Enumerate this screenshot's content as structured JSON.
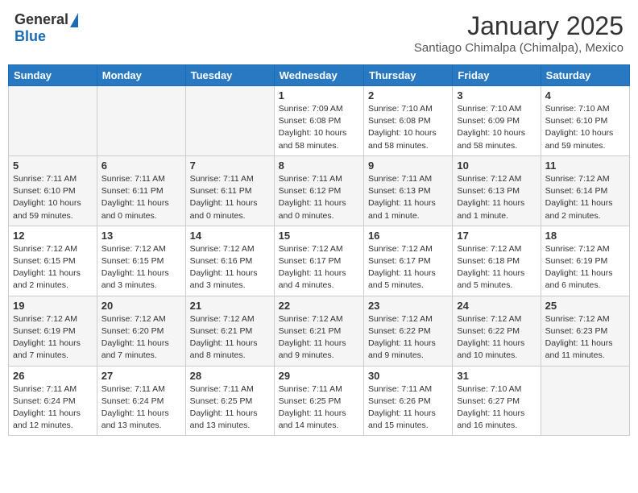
{
  "header": {
    "logo_general": "General",
    "logo_blue": "Blue",
    "title": "January 2025",
    "subtitle": "Santiago Chimalpa (Chimalpa), Mexico"
  },
  "days_of_week": [
    "Sunday",
    "Monday",
    "Tuesday",
    "Wednesday",
    "Thursday",
    "Friday",
    "Saturday"
  ],
  "weeks": [
    [
      {
        "day": "",
        "info": ""
      },
      {
        "day": "",
        "info": ""
      },
      {
        "day": "",
        "info": ""
      },
      {
        "day": "1",
        "info": "Sunrise: 7:09 AM\nSunset: 6:08 PM\nDaylight: 10 hours and 58 minutes."
      },
      {
        "day": "2",
        "info": "Sunrise: 7:10 AM\nSunset: 6:08 PM\nDaylight: 10 hours and 58 minutes."
      },
      {
        "day": "3",
        "info": "Sunrise: 7:10 AM\nSunset: 6:09 PM\nDaylight: 10 hours and 58 minutes."
      },
      {
        "day": "4",
        "info": "Sunrise: 7:10 AM\nSunset: 6:10 PM\nDaylight: 10 hours and 59 minutes."
      }
    ],
    [
      {
        "day": "5",
        "info": "Sunrise: 7:11 AM\nSunset: 6:10 PM\nDaylight: 10 hours and 59 minutes."
      },
      {
        "day": "6",
        "info": "Sunrise: 7:11 AM\nSunset: 6:11 PM\nDaylight: 11 hours and 0 minutes."
      },
      {
        "day": "7",
        "info": "Sunrise: 7:11 AM\nSunset: 6:11 PM\nDaylight: 11 hours and 0 minutes."
      },
      {
        "day": "8",
        "info": "Sunrise: 7:11 AM\nSunset: 6:12 PM\nDaylight: 11 hours and 0 minutes."
      },
      {
        "day": "9",
        "info": "Sunrise: 7:11 AM\nSunset: 6:13 PM\nDaylight: 11 hours and 1 minute."
      },
      {
        "day": "10",
        "info": "Sunrise: 7:12 AM\nSunset: 6:13 PM\nDaylight: 11 hours and 1 minute."
      },
      {
        "day": "11",
        "info": "Sunrise: 7:12 AM\nSunset: 6:14 PM\nDaylight: 11 hours and 2 minutes."
      }
    ],
    [
      {
        "day": "12",
        "info": "Sunrise: 7:12 AM\nSunset: 6:15 PM\nDaylight: 11 hours and 2 minutes."
      },
      {
        "day": "13",
        "info": "Sunrise: 7:12 AM\nSunset: 6:15 PM\nDaylight: 11 hours and 3 minutes."
      },
      {
        "day": "14",
        "info": "Sunrise: 7:12 AM\nSunset: 6:16 PM\nDaylight: 11 hours and 3 minutes."
      },
      {
        "day": "15",
        "info": "Sunrise: 7:12 AM\nSunset: 6:17 PM\nDaylight: 11 hours and 4 minutes."
      },
      {
        "day": "16",
        "info": "Sunrise: 7:12 AM\nSunset: 6:17 PM\nDaylight: 11 hours and 5 minutes."
      },
      {
        "day": "17",
        "info": "Sunrise: 7:12 AM\nSunset: 6:18 PM\nDaylight: 11 hours and 5 minutes."
      },
      {
        "day": "18",
        "info": "Sunrise: 7:12 AM\nSunset: 6:19 PM\nDaylight: 11 hours and 6 minutes."
      }
    ],
    [
      {
        "day": "19",
        "info": "Sunrise: 7:12 AM\nSunset: 6:19 PM\nDaylight: 11 hours and 7 minutes."
      },
      {
        "day": "20",
        "info": "Sunrise: 7:12 AM\nSunset: 6:20 PM\nDaylight: 11 hours and 7 minutes."
      },
      {
        "day": "21",
        "info": "Sunrise: 7:12 AM\nSunset: 6:21 PM\nDaylight: 11 hours and 8 minutes."
      },
      {
        "day": "22",
        "info": "Sunrise: 7:12 AM\nSunset: 6:21 PM\nDaylight: 11 hours and 9 minutes."
      },
      {
        "day": "23",
        "info": "Sunrise: 7:12 AM\nSunset: 6:22 PM\nDaylight: 11 hours and 9 minutes."
      },
      {
        "day": "24",
        "info": "Sunrise: 7:12 AM\nSunset: 6:22 PM\nDaylight: 11 hours and 10 minutes."
      },
      {
        "day": "25",
        "info": "Sunrise: 7:12 AM\nSunset: 6:23 PM\nDaylight: 11 hours and 11 minutes."
      }
    ],
    [
      {
        "day": "26",
        "info": "Sunrise: 7:11 AM\nSunset: 6:24 PM\nDaylight: 11 hours and 12 minutes."
      },
      {
        "day": "27",
        "info": "Sunrise: 7:11 AM\nSunset: 6:24 PM\nDaylight: 11 hours and 13 minutes."
      },
      {
        "day": "28",
        "info": "Sunrise: 7:11 AM\nSunset: 6:25 PM\nDaylight: 11 hours and 13 minutes."
      },
      {
        "day": "29",
        "info": "Sunrise: 7:11 AM\nSunset: 6:25 PM\nDaylight: 11 hours and 14 minutes."
      },
      {
        "day": "30",
        "info": "Sunrise: 7:11 AM\nSunset: 6:26 PM\nDaylight: 11 hours and 15 minutes."
      },
      {
        "day": "31",
        "info": "Sunrise: 7:10 AM\nSunset: 6:27 PM\nDaylight: 11 hours and 16 minutes."
      },
      {
        "day": "",
        "info": ""
      }
    ]
  ]
}
